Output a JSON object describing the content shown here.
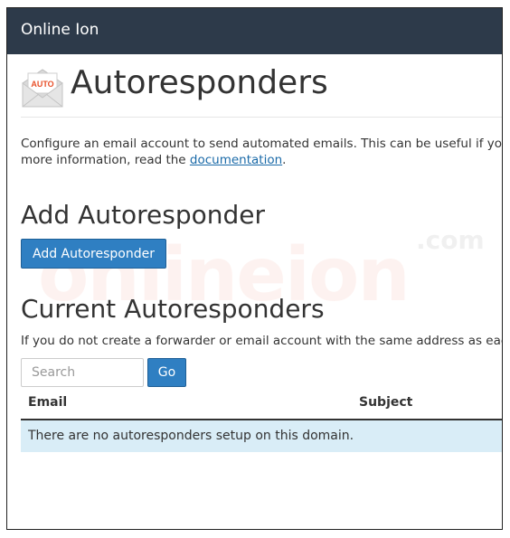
{
  "app": {
    "brand": "Online Ion"
  },
  "watermark": {
    "text": "onlineion",
    "suffix": ".com"
  },
  "page": {
    "icon_label": "AUTO",
    "title": "Autoresponders",
    "description_line1": "Configure an email account to send automated emails. This can be useful if you are on vacation or unavailable, or if you have a generic message that you wish to send from a support email address. For",
    "description_line2_prefix": "more information, read the ",
    "description_link": "documentation",
    "description_line2_suffix": "."
  },
  "add_section": {
    "heading": "Add Autoresponder",
    "button_label": "Add Autoresponder"
  },
  "current_section": {
    "heading": "Current Autoresponders",
    "info": "If you do not create a forwarder or email account with the same address as each autoresponder, mail will only be handled by the autoresponder before it is discarded.",
    "search": {
      "placeholder": "Search",
      "value": ""
    },
    "go_label": "Go",
    "table": {
      "columns": [
        "Email",
        "Subject"
      ],
      "empty_message": "There are no autoresponders setup on this domain."
    }
  },
  "colors": {
    "topbar": "#2d3a4a",
    "primary_button": "#2f7fc2",
    "empty_row": "#d9edf7",
    "icon_accent": "#e8502a"
  }
}
